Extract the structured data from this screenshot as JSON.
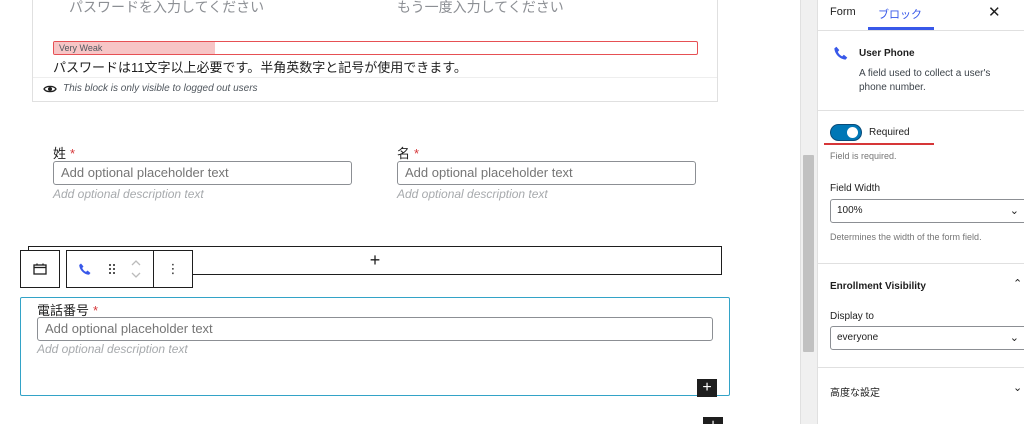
{
  "password_block": {
    "password_placeholder": "パスワードを入力してください",
    "confirm_placeholder": "もう一度入力してください",
    "strength_label": "Very Weak",
    "strength_level": 0.25,
    "hint": "パスワードは11文字以上必要です。半角英数字と記号が使用できます。",
    "visibility_note": "This block is only visible to logged out users"
  },
  "name_fields": {
    "last_name_label": "姓",
    "first_name_label": "名",
    "required_mark": "*",
    "placeholder": "Add optional placeholder text",
    "description": "Add optional description text"
  },
  "appender": {
    "plus": "+"
  },
  "toolbar": {
    "calendar_icon": "calendar-icon",
    "phone_icon": "phone-icon",
    "drag_icon": "drag-handle-icon",
    "more_glyph": "⋮"
  },
  "phone_block": {
    "label": "電話番号",
    "required_mark": "*",
    "placeholder": "Add optional placeholder text",
    "description": "Add optional description text",
    "add_glyph": "+"
  },
  "sidebar": {
    "tab_form": "Form",
    "tab_block": "ブロック",
    "close_glyph": "✕",
    "block_title": "User Phone",
    "block_description": "A field used to collect a user's phone number.",
    "required_label": "Required",
    "required_on": true,
    "required_help": "Field is required.",
    "field_width_label": "Field Width",
    "field_width_value": "100%",
    "field_width_help": "Determines the width of the form field.",
    "enrollment_title": "Enrollment Visibility",
    "display_to_label": "Display to",
    "display_to_value": "everyone",
    "advanced_title": "高度な設定"
  },
  "colors": {
    "accent": "#3858e9",
    "required": "#d63638",
    "selected_border": "#33a3c7"
  }
}
